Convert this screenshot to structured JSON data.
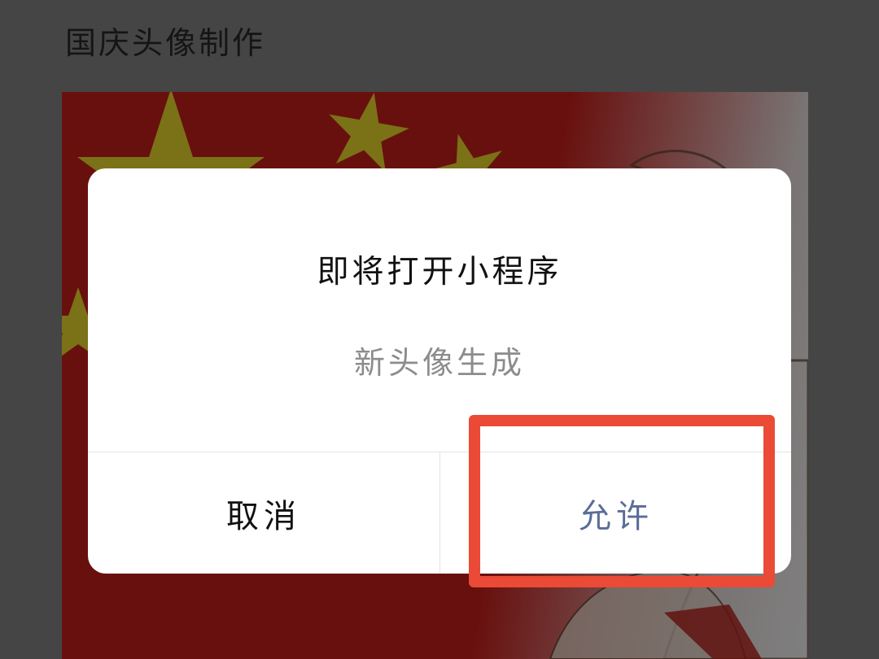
{
  "page": {
    "title": "国庆头像制作"
  },
  "poster": {
    "flag_color": "#d1201c",
    "star_color": "#f6e22e"
  },
  "dialog": {
    "title": "即将打开小程序",
    "subtitle": "新头像生成",
    "cancel_label": "取消",
    "allow_label": "允许"
  },
  "annotation": {
    "highlight_color": "#ea4a36",
    "highlighted_element": "allow-button"
  }
}
